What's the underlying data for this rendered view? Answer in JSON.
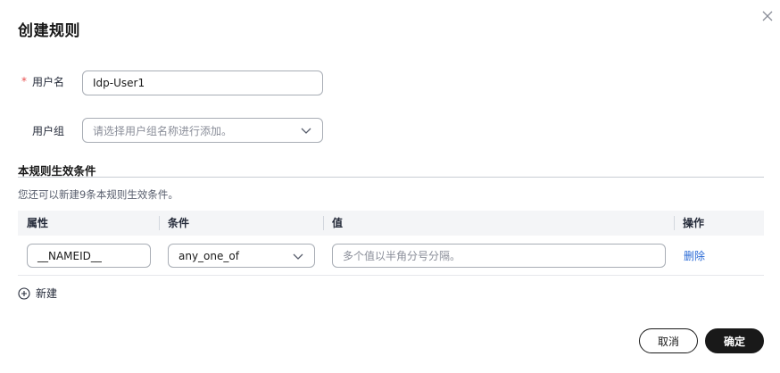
{
  "dialog": {
    "title": "创建规则"
  },
  "form": {
    "username": {
      "label": "用户名",
      "required_mark": "*",
      "value": "Idp-User1"
    },
    "usergroup": {
      "label": "用户组",
      "placeholder": "请选择用户组名称进行添加。"
    }
  },
  "conditions": {
    "title": "本规则生效条件",
    "hint": "您还可以新建9条本规则生效条件。",
    "columns": [
      "属性",
      "条件",
      "值",
      "操作"
    ],
    "rows": [
      {
        "attribute": "__NAMEID__",
        "condition": "any_one_of",
        "value_placeholder": "多个值以半角分号分隔。",
        "action": "删除"
      }
    ],
    "add_label": "新建"
  },
  "footer": {
    "cancel_label": "取消",
    "ok_label": "确定"
  },
  "icons": {
    "close": "close-icon",
    "chevron": "chevron-down-icon",
    "add": "plus-circle-icon"
  },
  "colors": {
    "primary_button": "#191919",
    "link": "#2a6ad6",
    "required": "#e84e4e"
  }
}
